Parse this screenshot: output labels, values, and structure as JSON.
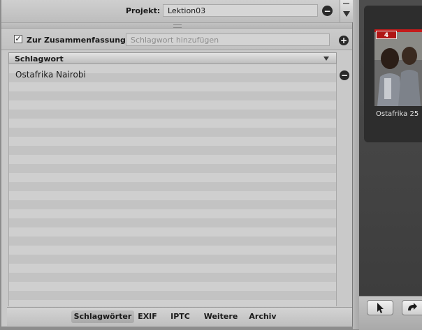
{
  "project": {
    "label": "Projekt:",
    "value": "Lektion03"
  },
  "summary": {
    "checkbox_checked": true,
    "checkbox_label": "Zur Zusammenfassung",
    "keyword_placeholder": "Schlagwort hinzufügen"
  },
  "keyword_list": {
    "column_header": "Schlagwort",
    "items": [
      "Ostafrika Nairobi"
    ]
  },
  "tabs": [
    "Schlagwörter",
    "EXIF",
    "IPTC",
    "Weitere",
    "Archiv"
  ],
  "active_tab_index": 0,
  "browser": {
    "badge": "4",
    "thumbnail_caption": "Ostafrika 25"
  },
  "icons": {
    "remove": "minus-circle-icon",
    "add": "plus-circle-icon",
    "checkbox": "checkmark-icon",
    "sort": "triangle-down-icon",
    "select_tool": "arrow-pointer-icon",
    "rotate_tool": "rotate-icon"
  },
  "colors": {
    "panel_background": "#c9c9c9",
    "browser_background": "#3b3b3b",
    "badge_red": "#b01515"
  }
}
